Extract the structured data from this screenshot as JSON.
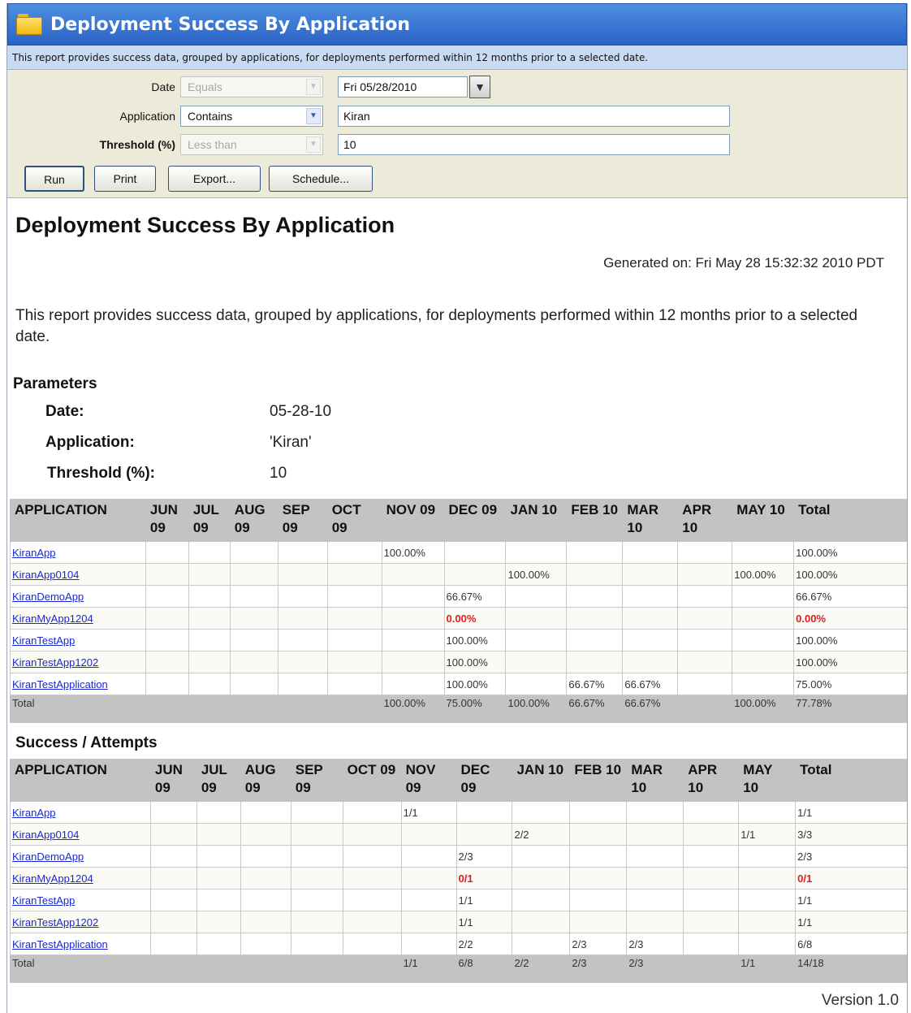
{
  "window": {
    "title": "Deployment Success By Application",
    "subtitle": "This report provides success data, grouped by applications, for deployments performed within 12 months prior to a selected date."
  },
  "form": {
    "date": {
      "label": "Date",
      "operator": "Equals",
      "value": "Fri 05/28/2010"
    },
    "application": {
      "label": "Application",
      "operator": "Contains",
      "value": "Kiran"
    },
    "threshold": {
      "label": "Threshold (%)",
      "operator": "Less than",
      "value": "10"
    },
    "buttons": {
      "run": "Run",
      "print": "Print",
      "export": "Export...",
      "schedule": "Schedule..."
    }
  },
  "report": {
    "title": "Deployment Success By Application",
    "generated": "Generated on: Fri May 28 15:32:32 2010 PDT",
    "description": "This report provides success data, grouped by applications, for deployments performed within 12 months prior to a selected date.",
    "parameters": {
      "heading": "Parameters",
      "date_label": "Date:",
      "date_value": "05-28-10",
      "app_label": "Application:",
      "app_value": "'Kiran'",
      "threshold_label": "Threshold (%):",
      "threshold_value": "10"
    },
    "table1": {
      "headers": [
        "APPLICATION",
        "JUN 09",
        "JUL 09",
        "AUG 09",
        "SEP 09",
        "OCT 09",
        "NOV 09",
        "DEC 09",
        "JAN 10",
        "FEB 10",
        "MAR 10",
        "APR 10",
        "MAY 10",
        "Total"
      ],
      "rows": [
        [
          "KiranApp",
          "",
          "",
          "",
          "",
          "",
          "100.00%",
          "",
          "",
          "",
          "",
          "",
          "",
          "100.00%"
        ],
        [
          "KiranApp0104",
          "",
          "",
          "",
          "",
          "",
          "",
          "",
          "100.00%",
          "",
          "",
          "",
          "100.00%",
          "100.00%"
        ],
        [
          "KiranDemoApp",
          "",
          "",
          "",
          "",
          "",
          "",
          "66.67%",
          "",
          "",
          "",
          "",
          "",
          "66.67%"
        ],
        [
          "KiranMyApp1204",
          "",
          "",
          "",
          "",
          "",
          "",
          "0.00%",
          "",
          "",
          "",
          "",
          "",
          "0.00%"
        ],
        [
          "KiranTestApp",
          "",
          "",
          "",
          "",
          "",
          "",
          "100.00%",
          "",
          "",
          "",
          "",
          "",
          "100.00%"
        ],
        [
          "KiranTestApp1202",
          "",
          "",
          "",
          "",
          "",
          "",
          "100.00%",
          "",
          "",
          "",
          "",
          "",
          "100.00%"
        ],
        [
          "KiranTestApplication",
          "",
          "",
          "",
          "",
          "",
          "",
          "100.00%",
          "",
          "66.67%",
          "66.67%",
          "",
          "",
          "75.00%"
        ]
      ],
      "total": [
        "Total",
        "",
        "",
        "",
        "",
        "",
        "100.00%",
        "75.00%",
        "100.00%",
        "66.67%",
        "66.67%",
        "",
        "100.00%",
        "77.78%"
      ]
    },
    "success_heading": "Success / Attempts",
    "table2": {
      "headers": [
        "APPLICATION",
        "JUN 09",
        "JUL 09",
        "AUG 09",
        "SEP 09",
        "OCT 09",
        "NOV 09",
        "DEC 09",
        "JAN 10",
        "FEB 10",
        "MAR 10",
        "APR 10",
        "MAY 10",
        "Total"
      ],
      "rows": [
        [
          "KiranApp",
          "",
          "",
          "",
          "",
          "",
          "1/1",
          "",
          "",
          "",
          "",
          "",
          "",
          "1/1"
        ],
        [
          "KiranApp0104",
          "",
          "",
          "",
          "",
          "",
          "",
          "",
          "2/2",
          "",
          "",
          "",
          "1/1",
          "3/3"
        ],
        [
          "KiranDemoApp",
          "",
          "",
          "",
          "",
          "",
          "",
          "2/3",
          "",
          "",
          "",
          "",
          "",
          "2/3"
        ],
        [
          "KiranMyApp1204",
          "",
          "",
          "",
          "",
          "",
          "",
          "0/1",
          "",
          "",
          "",
          "",
          "",
          "0/1"
        ],
        [
          "KiranTestApp",
          "",
          "",
          "",
          "",
          "",
          "",
          "1/1",
          "",
          "",
          "",
          "",
          "",
          "1/1"
        ],
        [
          "KiranTestApp1202",
          "",
          "",
          "",
          "",
          "",
          "",
          "1/1",
          "",
          "",
          "",
          "",
          "",
          "1/1"
        ],
        [
          "KiranTestApplication",
          "",
          "",
          "",
          "",
          "",
          "",
          "2/2",
          "",
          "2/3",
          "2/3",
          "",
          "",
          "6/8"
        ]
      ],
      "total": [
        "Total",
        "",
        "",
        "",
        "",
        "",
        "1/1",
        "6/8",
        "2/2",
        "2/3",
        "2/3",
        "",
        "1/1",
        "14/18"
      ]
    },
    "failed_row": "KiranMyApp1204",
    "version": "Version 1.0"
  },
  "colors": {
    "titlebar": "#2a63c6",
    "link": "#1a28d0",
    "fail": "#e31b1b",
    "table_header": "#c3c3c3",
    "form_bg": "#ecebd9"
  },
  "icons": {
    "title": "folder-icon",
    "dropdown": "chevron-down-icon",
    "date_picker": "triangle-down-icon"
  }
}
